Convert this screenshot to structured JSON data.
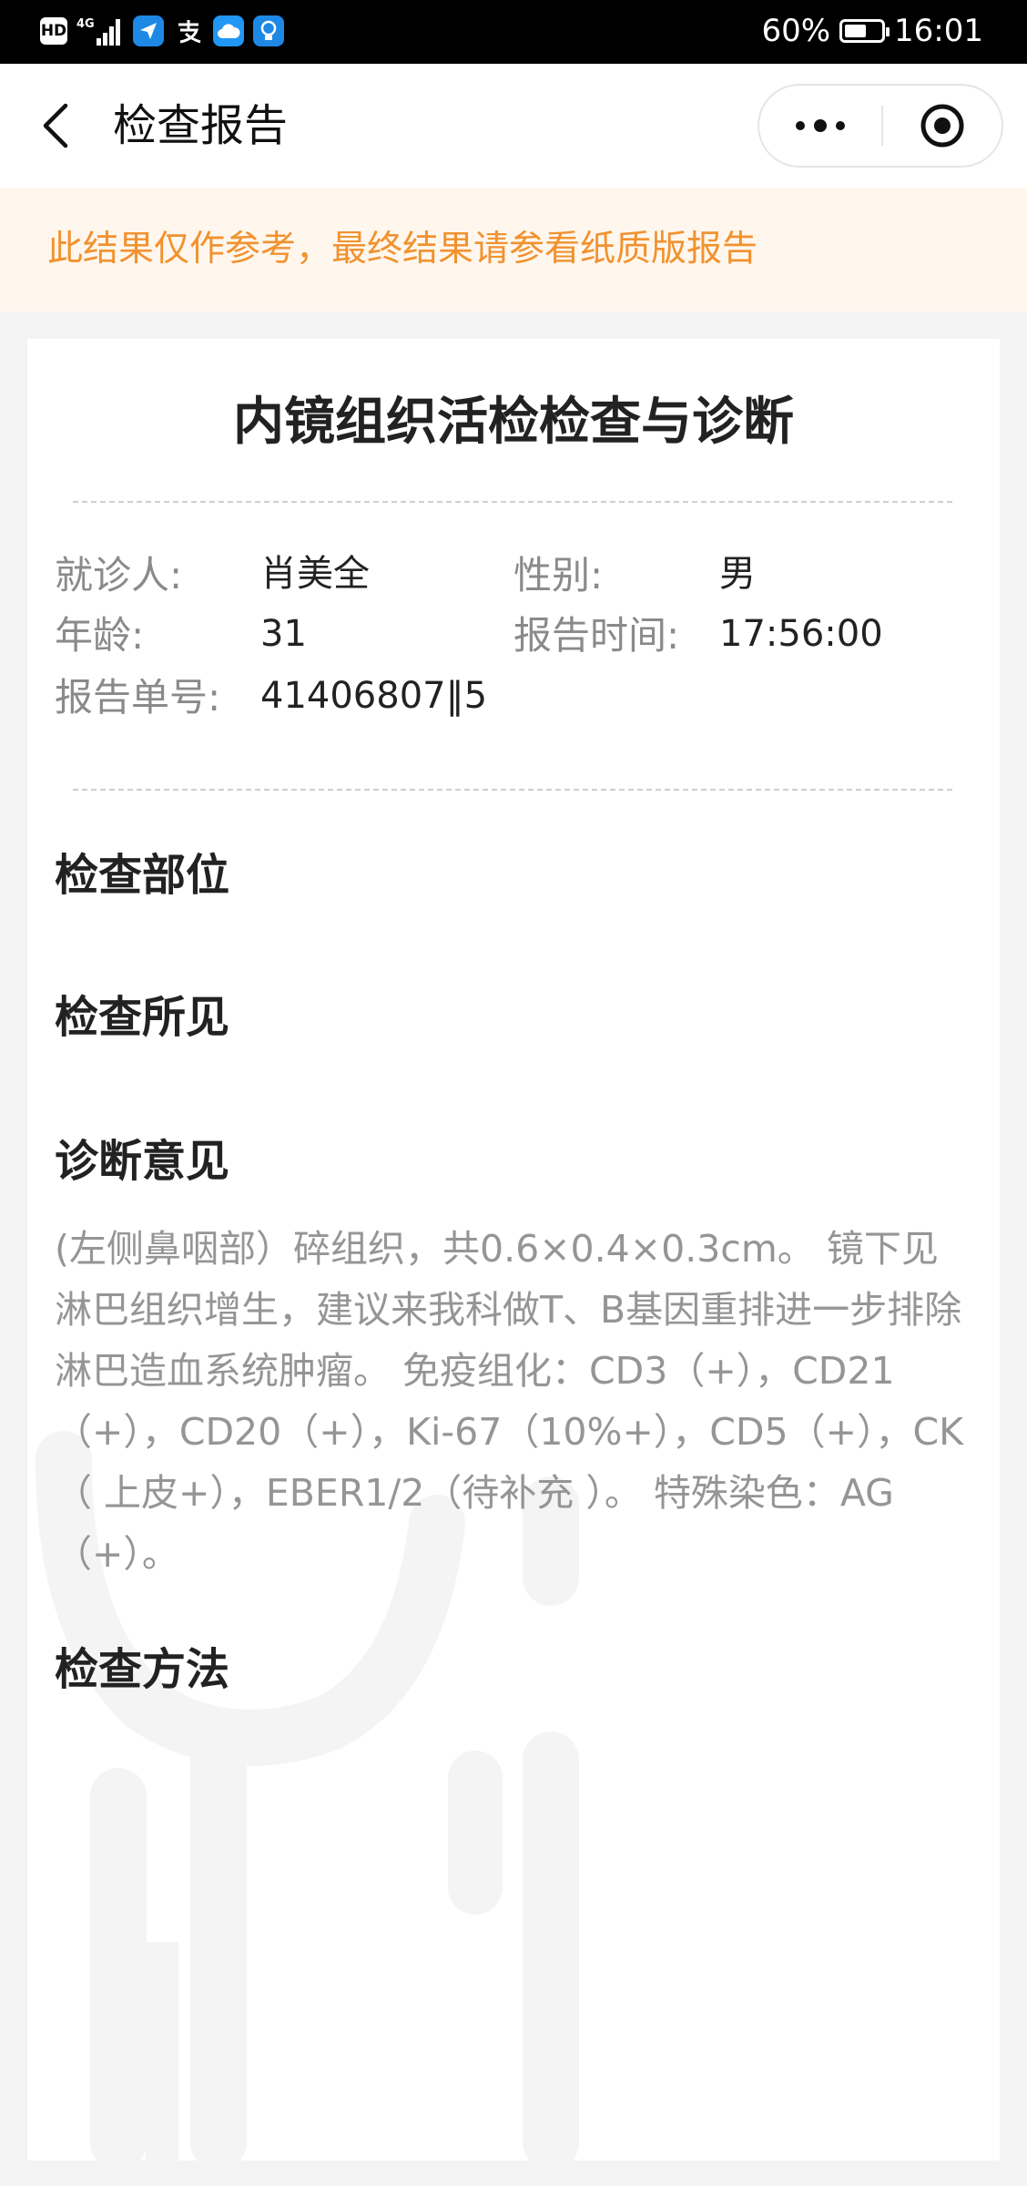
{
  "status_bar": {
    "hd_label": "HD",
    "network_label": "4G",
    "battery_percent_text": "60%",
    "battery_level": 0.6,
    "time": "16:01",
    "app_icons": [
      "paper-plane-icon",
      "alipay-icon",
      "cloud-icon",
      "lightbulb-icon"
    ]
  },
  "nav": {
    "title": "检查报告",
    "back_icon": "chevron-left-icon",
    "more_icon": "more-dots-icon",
    "close_icon": "target-circle-icon"
  },
  "notice": {
    "text": "此结果仅作参考，最终结果请参看纸质版报告",
    "color": "#f1922f",
    "background": "#fff7ee"
  },
  "report": {
    "title": "内镜组织活检检查与诊断",
    "patient": {
      "name_label": "就诊人:",
      "name_value": "肖美全",
      "gender_label": "性别:",
      "gender_value": "男",
      "age_label": "年龄:",
      "age_value": "31",
      "time_label": "报告时间:",
      "time_value": "17:56:00",
      "number_label": "报告单号:",
      "number_value": "41406807‖5"
    },
    "sections": {
      "site_title": "检查部位",
      "findings_title": "检查所见",
      "diagnosis_title": "诊断意见",
      "diagnosis_text": "(左侧鼻咽部）碎组织，共0.6×0.4×0.3cm。 镜下见淋巴组织增生，建议来我科做T、B基因重排进一步排除淋巴造血系统肿瘤。 免疫组化：CD3（+），CD21（+），CD20（+），Ki-67（10%+），CD5（+），CK（ 上皮+），EBER1/2（待补充 ）。 特殊染色：AG（+）。",
      "method_title": "检查方法"
    }
  }
}
